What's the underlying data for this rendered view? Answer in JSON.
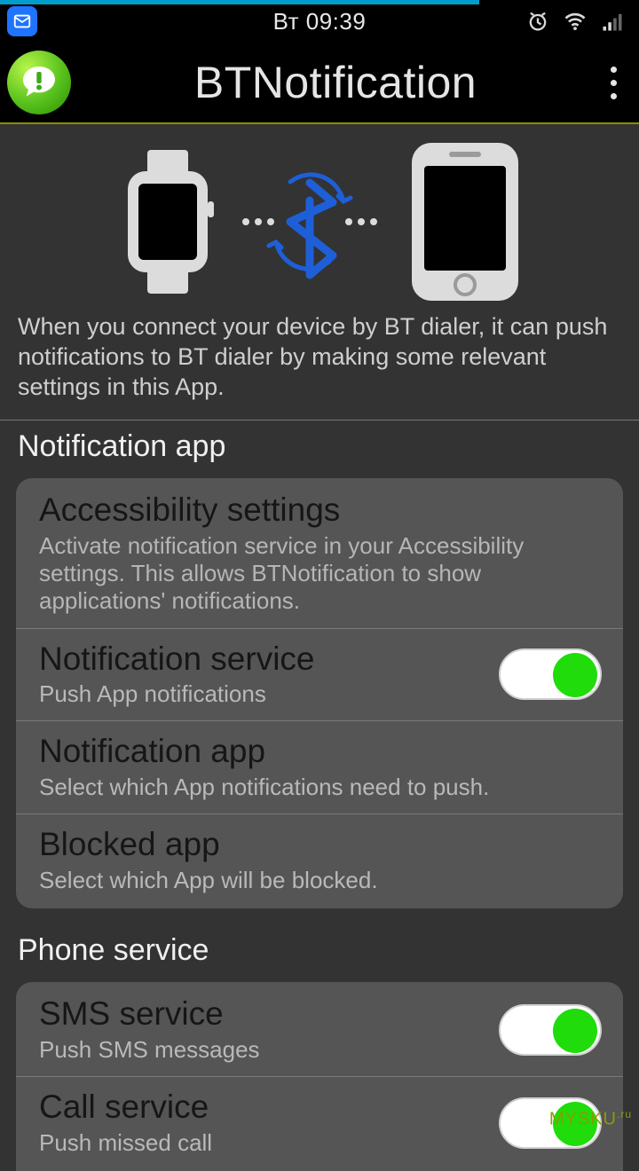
{
  "statusbar": {
    "clock": "Вт 09:39"
  },
  "appbar": {
    "title": "BTNotification"
  },
  "hero": {
    "description": "When you connect your device by BT dialer, it can push notifications to BT dialer by making some relevant settings in this App."
  },
  "sections": {
    "notification": {
      "header": "Notification app",
      "items": {
        "accessibility": {
          "title": "Accessibility settings",
          "sub": "Activate notification service in your Accessibility settings. This allows BTNotification to show applications' notifications."
        },
        "service": {
          "title": "Notification service",
          "sub": "Push App notifications",
          "toggle": true
        },
        "app": {
          "title": "Notification app",
          "sub": "Select which App notifications need to push."
        },
        "blocked": {
          "title": "Blocked app",
          "sub": "Select which App will be blocked."
        }
      }
    },
    "phone": {
      "header": "Phone service",
      "items": {
        "sms": {
          "title": "SMS service",
          "sub": "Push SMS messages",
          "toggle": true
        },
        "call": {
          "title": "Call service",
          "sub": "Push missed call",
          "toggle": true
        }
      }
    }
  },
  "watermark": {
    "text": "MYSKU",
    "suffix": ".ru"
  }
}
